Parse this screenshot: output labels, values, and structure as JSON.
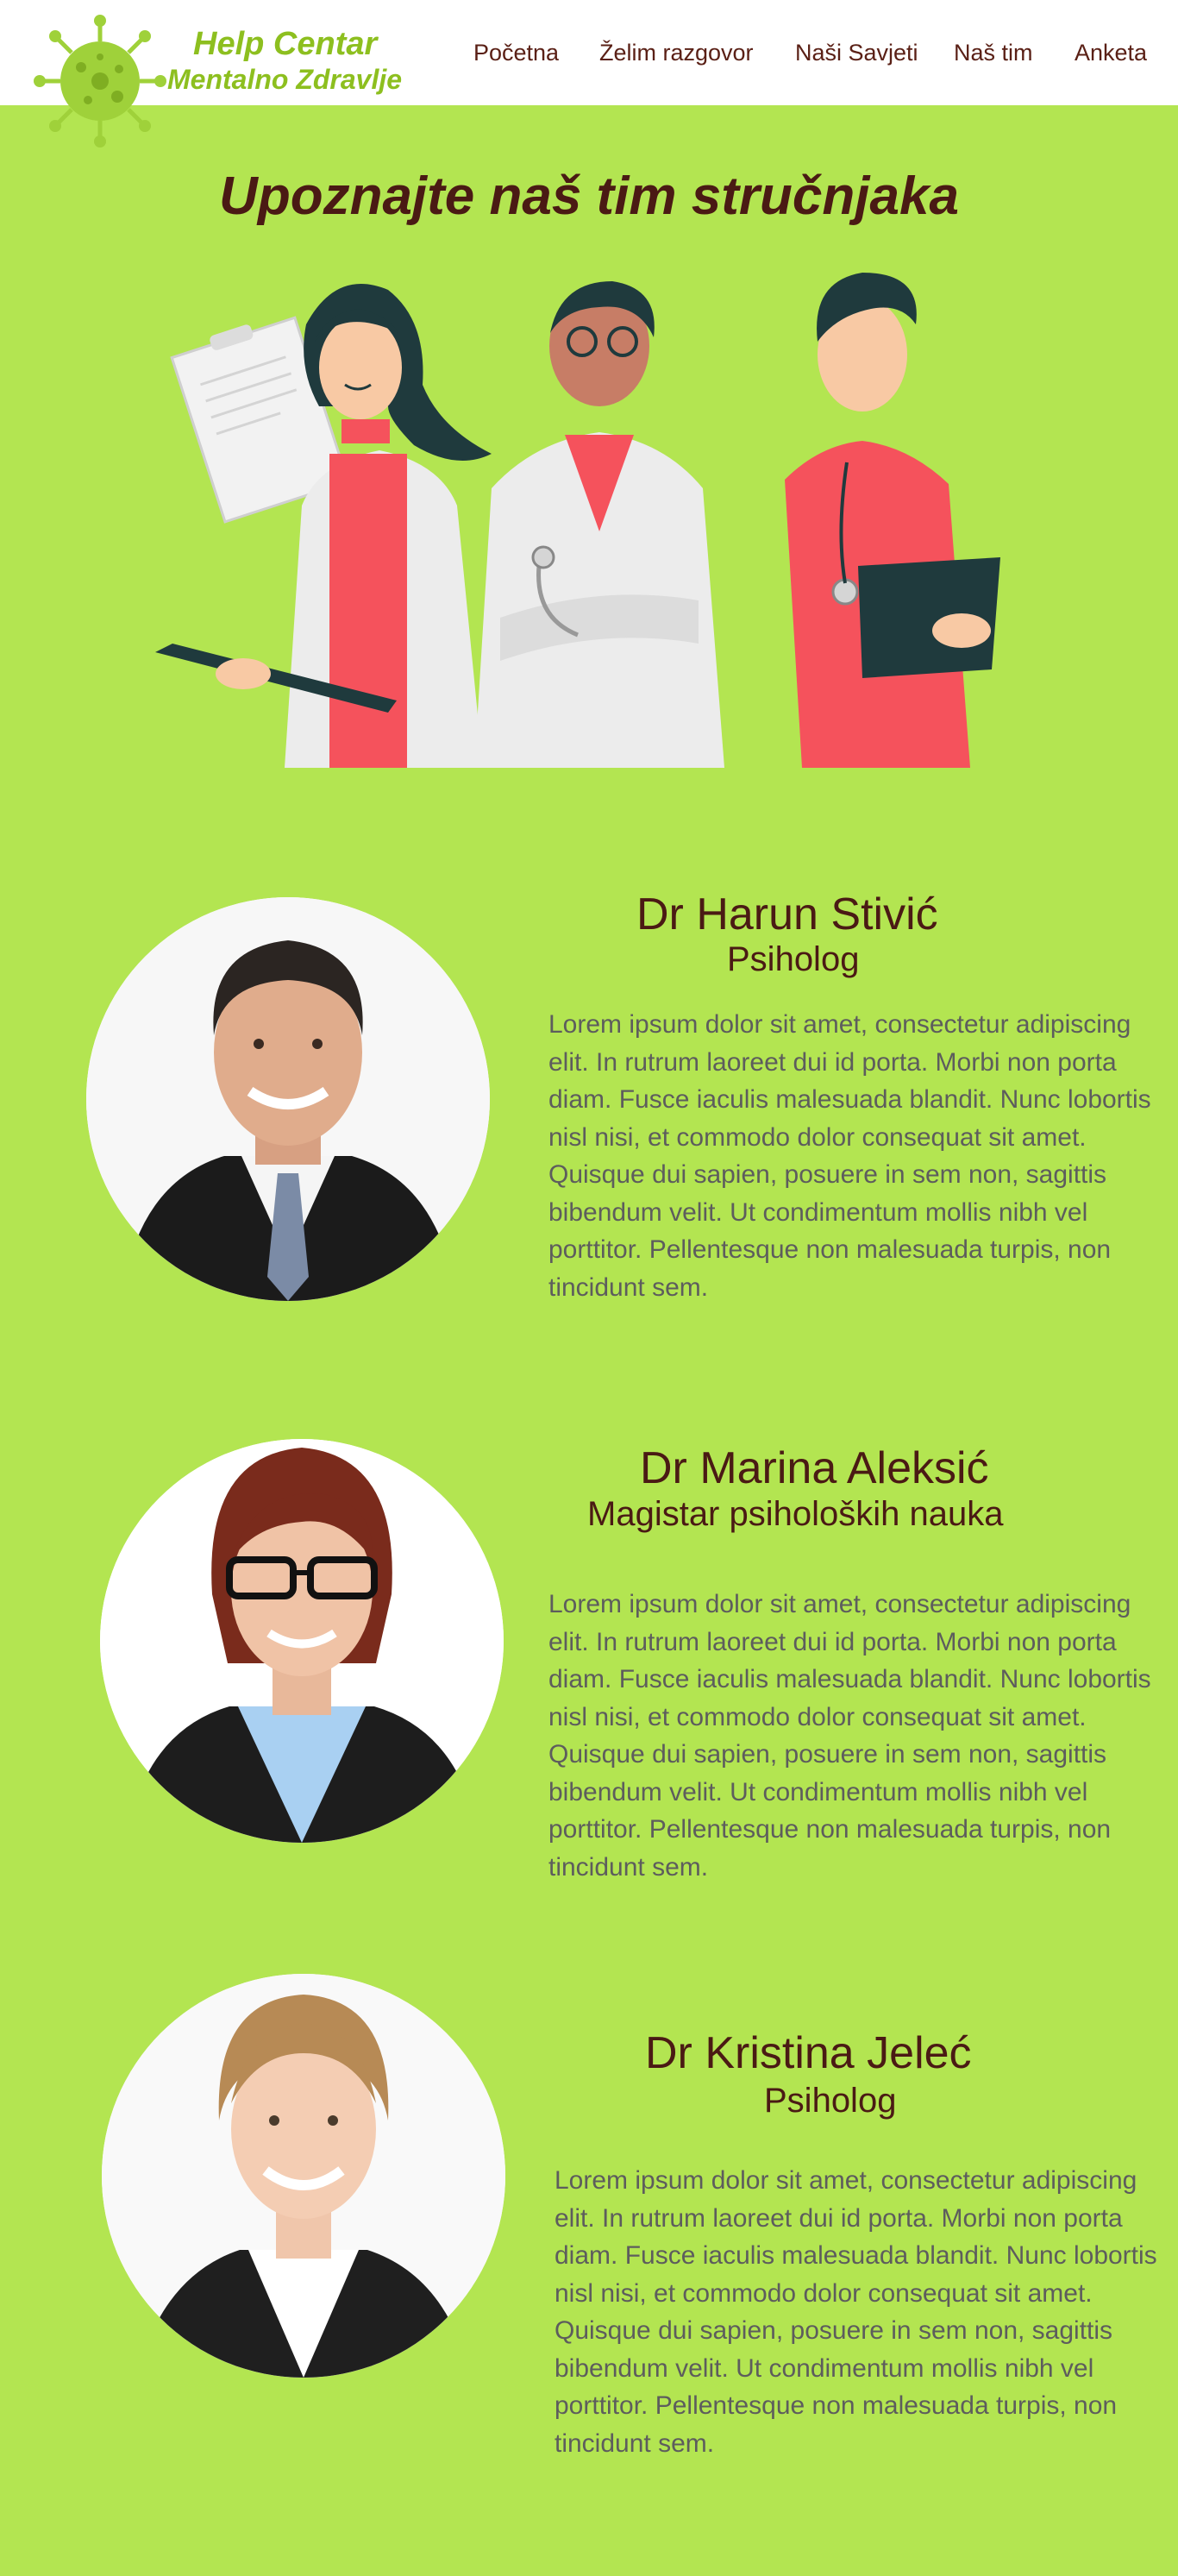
{
  "header": {
    "brand_line1": "Help Centar",
    "brand_line2": "Mentalno Zdravlje",
    "logo_icon": "virus-icon",
    "nav": [
      {
        "label": "Početna"
      },
      {
        "label": "Želim razgovor"
      },
      {
        "label": "Naši Savjeti"
      },
      {
        "label": "Naš tim"
      },
      {
        "label": "Anketa"
      }
    ]
  },
  "main": {
    "title": "Upoznajte naš tim stručnjaka",
    "illustration": "three-medical-staff-illustration"
  },
  "team": [
    {
      "name": "Dr Harun Stivić",
      "title": "Psiholog",
      "bio": "Lorem ipsum dolor sit amet, consectetur adipiscing elit. In rutrum laoreet dui id porta. Morbi non porta diam. Fusce iaculis malesuada blandit. Nunc lobortis nisl nisi, et commodo dolor consequat sit amet. Quisque dui sapien, posuere in sem non, sagittis bibendum velit. Ut condimentum mollis nibh vel porttitor. Pellentesque non malesuada turpis, non tincidunt sem."
    },
    {
      "name": "Dr Marina Aleksić",
      "title": "Magistar psiholoških nauka",
      "bio": "Lorem ipsum dolor sit amet, consectetur adipiscing elit. In rutrum laoreet dui id porta. Morbi non porta diam. Fusce iaculis malesuada blandit. Nunc lobortis nisl nisi, et commodo dolor consequat sit amet. Quisque dui sapien, posuere in sem non, sagittis bibendum velit. Ut condimentum mollis nibh vel porttitor. Pellentesque non malesuada turpis, non tincidunt sem."
    },
    {
      "name": "Dr Kristina Jelеć",
      "title": "Psiholog",
      "bio": "Lorem ipsum dolor sit amet, consectetur adipiscing elit. In rutrum laoreet dui id porta. Morbi non porta diam. Fusce iaculis malesuada blandit. Nunc lobortis nisl nisi, et commodo dolor consequat sit amet. Quisque dui sapien, posuere in sem non, sagittis bibendum velit. Ut condimentum mollis nibh vel porttitor. Pellentesque non malesuada turpis, non tincidunt sem."
    }
  ],
  "colors": {
    "background": "#b3e551",
    "brand_green": "#8dbf1f",
    "heading": "#4a1a14",
    "body_text": "#5d5d5d",
    "accent_red": "#f5525c"
  }
}
